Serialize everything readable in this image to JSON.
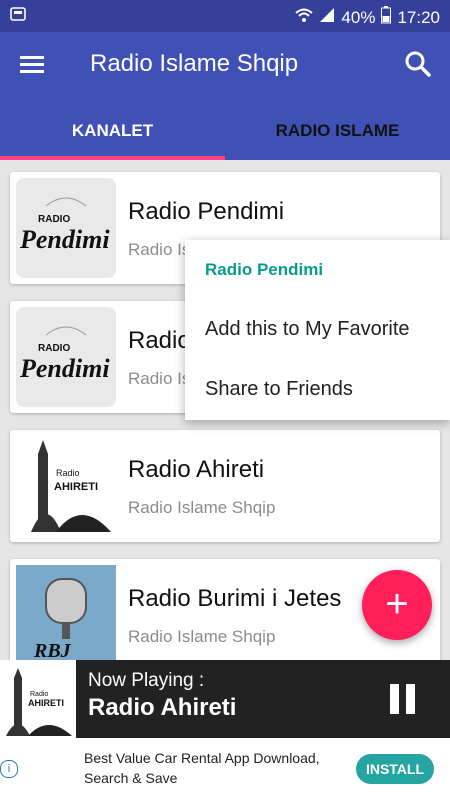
{
  "statusbar": {
    "battery_percent": "40%",
    "time": "17:20",
    "icons": [
      "notification-icon",
      "wifi-icon",
      "signal-icon",
      "battery-icon"
    ]
  },
  "appbar": {
    "title": "Radio Islame Shqip",
    "icons": [
      "menu-icon",
      "search-icon"
    ],
    "tabs": [
      {
        "label": "KANALET",
        "active": true
      },
      {
        "label": "RADIO ISLAME",
        "active": false
      }
    ]
  },
  "list": {
    "items": [
      {
        "title": "Radio Pendimi",
        "subtitle": "Radio Islame Shqip",
        "logo": "pendimi"
      },
      {
        "title": "Radio Pendimi",
        "subtitle": "Radio Islame Shqip",
        "logo": "pendimi"
      },
      {
        "title": "Radio Ahireti",
        "subtitle": "Radio Islame Shqip",
        "logo": "ahireti"
      },
      {
        "title": "Radio Burimi i Jetes",
        "subtitle": "Radio Islame Shqip",
        "logo": "rbj"
      }
    ],
    "logo_texts": {
      "pendimi_small": "RADIO",
      "pendimi_main": "Pendimi",
      "ahireti_small": "Radio",
      "ahireti_main": "AHIRETI",
      "rbj": "RBJ"
    }
  },
  "popup": {
    "header": "Radio Pendimi",
    "items": [
      "Add this to My Favorite",
      "Share to Friends"
    ]
  },
  "fab": {
    "label": "+"
  },
  "player": {
    "label": "Now Playing :",
    "title": "Radio Ahireti"
  },
  "ad": {
    "text": "Best Value Car Rental App Download, Search & Save",
    "button": "INSTALL"
  },
  "colors": {
    "primary": "#3f51b5",
    "primary_dark": "#34409a",
    "accent": "#ff4081",
    "fab": "#ff1f5a",
    "popup_header": "#0a9b8d",
    "install": "#24a5a2"
  }
}
